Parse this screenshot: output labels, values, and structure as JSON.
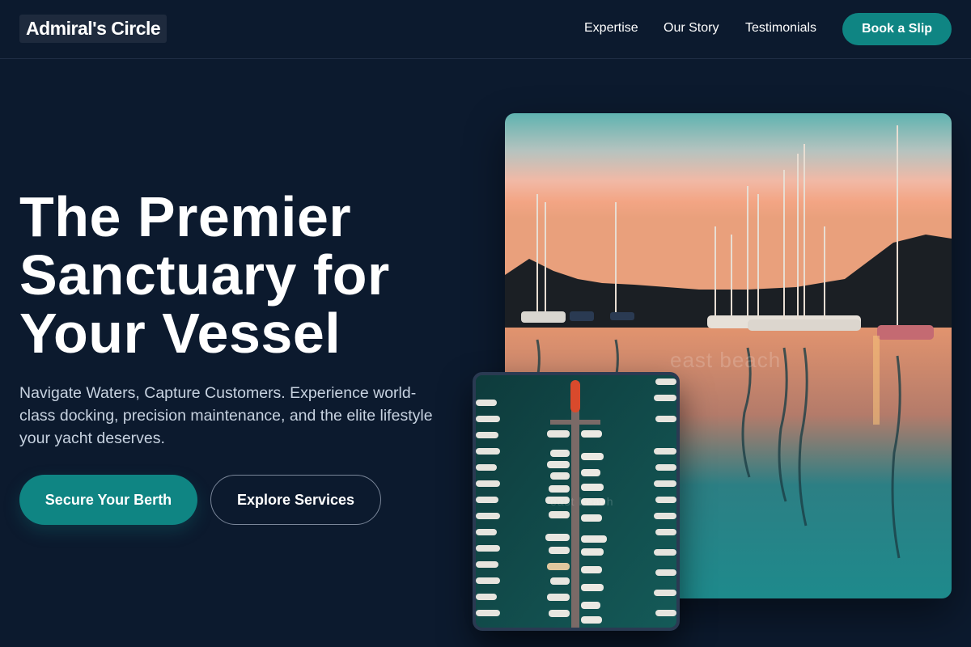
{
  "header": {
    "logo": "Admiral's Circle",
    "nav": [
      "Expertise",
      "Our Story",
      "Testimonials"
    ],
    "cta": "Book a Slip"
  },
  "hero": {
    "title": "The Premier Sanctuary for Your Vessel",
    "subtitle": "Navigate Waters, Capture Customers. Experience world-class docking, precision maintenance, and the elite lifestyle your yacht deserves.",
    "primary_button": "Secure Your Berth",
    "secondary_button": "Explore Services"
  },
  "images": {
    "main_alt": "Marina at sunset with sailboats reflected in water",
    "aerial_alt": "Aerial view of boats docked along a pier",
    "watermark_main": "east beach",
    "watermark_aerial": "east beach"
  },
  "colors": {
    "background": "#0c1a2e",
    "accent": "#0f8583",
    "text_muted": "#c7d2e0"
  }
}
